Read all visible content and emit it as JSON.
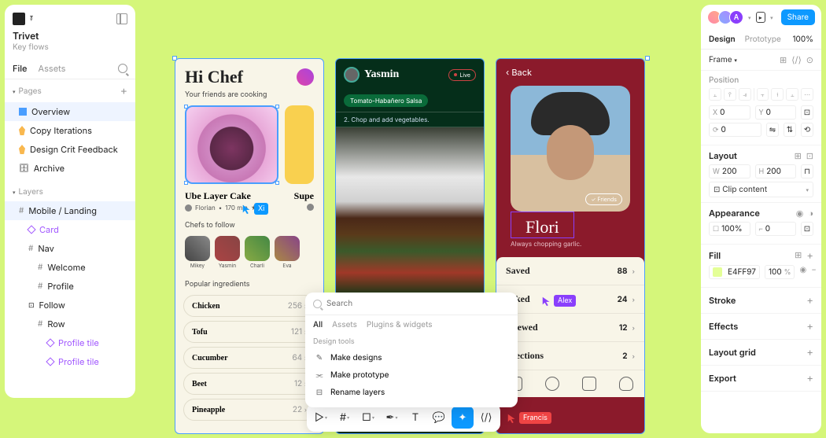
{
  "file": {
    "name": "Trivet",
    "subtitle": "Key flows"
  },
  "left_tabs": {
    "file": "File",
    "assets": "Assets"
  },
  "pages": {
    "header": "Pages",
    "items": [
      "Overview",
      "Copy Iterations",
      "Design Crit Feedback",
      "Archive"
    ]
  },
  "layers": {
    "header": "Layers",
    "root": "Mobile / Landing",
    "card": "Card",
    "nav": "Nav",
    "welcome": "Welcome",
    "profile": "Profile",
    "follow": "Follow",
    "row": "Row",
    "tile1": "Profile tile",
    "tile2": "Profile tile"
  },
  "right": {
    "share": "Share",
    "design": "Design",
    "prototype": "Prototype",
    "zoom": "100%",
    "frame": "Frame",
    "position": "Position",
    "x": "0",
    "y": "0",
    "rotation": "0",
    "layout": "Layout",
    "w": "200",
    "h": "200",
    "clip": "Clip content",
    "appearance": "Appearance",
    "opacity": "100%",
    "radius": "0",
    "fill": "Fill",
    "fill_hex": "E4FF97",
    "fill_pct": "100",
    "stroke": "Stroke",
    "effects": "Effects",
    "layout_grid": "Layout grid",
    "export": "Export"
  },
  "m1": {
    "title": "Hi Chef",
    "subtitle": "Your friends are cooking",
    "recipe1": "Ube Layer Cake",
    "recipe1_author": "Florian",
    "recipe1_time": "170 min",
    "recipe1_stars": "★",
    "recipe2": "Supe",
    "chefs_title": "Chefs to follow",
    "chefs": [
      "Mikey",
      "Yasmin",
      "Charli",
      "Eva"
    ],
    "ing_title": "Popular ingredients",
    "ingredients": [
      {
        "name": "Chicken",
        "count": "256"
      },
      {
        "name": "Tofu",
        "count": "121"
      },
      {
        "name": "Cucumber",
        "count": "64"
      },
      {
        "name": "Beet",
        "count": "12"
      },
      {
        "name": "Pineapple",
        "count": "22"
      }
    ]
  },
  "m2": {
    "name": "Yasmin",
    "live": "Live",
    "tag": "Tomato-Habañero Salsa",
    "step": "2. Chop and add vegetables."
  },
  "m3": {
    "back": "‹ Back",
    "friends": "✓ Friends",
    "name": "Flori",
    "subtitle": "Always chopping garlic.",
    "stats": [
      {
        "name": "Saved",
        "val": "88"
      },
      {
        "name": "ooked",
        "val": "24"
      },
      {
        "name": "eviewed",
        "val": "12"
      },
      {
        "name": "ollections",
        "val": "2"
      }
    ]
  },
  "cursors": {
    "xi": "Xi",
    "alex": "Alex",
    "francis": "Francis"
  },
  "search": {
    "placeholder": "Search",
    "tabs": [
      "All",
      "Assets",
      "Plugins & widgets"
    ],
    "group": "Design tools",
    "items": [
      "Make designs",
      "Make prototype",
      "Rename layers"
    ]
  }
}
